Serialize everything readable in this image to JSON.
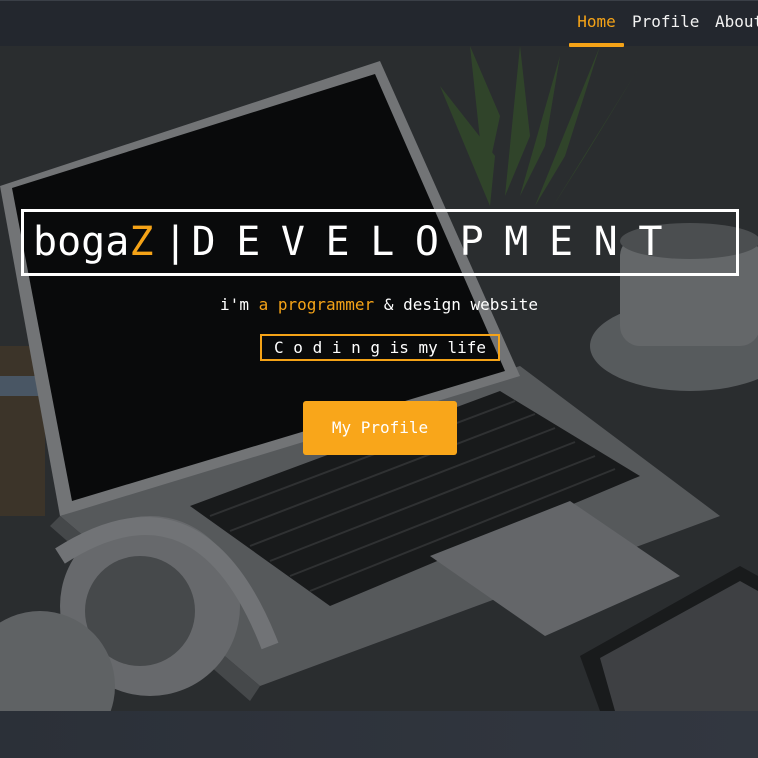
{
  "nav": {
    "items": [
      {
        "label": "Home",
        "active": true
      },
      {
        "label": "Profile",
        "active": false
      },
      {
        "label": "About",
        "active": false
      }
    ]
  },
  "hero": {
    "title_name": "boga",
    "title_accent": "Z",
    "title_separator": "|",
    "title_word": "DEVELOPMENT",
    "tagline_prefix": "i'm",
    "tagline_accent": "a programmer",
    "tagline_suffix": "& design website",
    "motto_spaced": "C o d i n g",
    "motto_rest": "is my life",
    "cta_label": "My Profile"
  },
  "colors": {
    "accent": "#f5a317",
    "navbar": "#23272e",
    "text": "#ffffff"
  }
}
